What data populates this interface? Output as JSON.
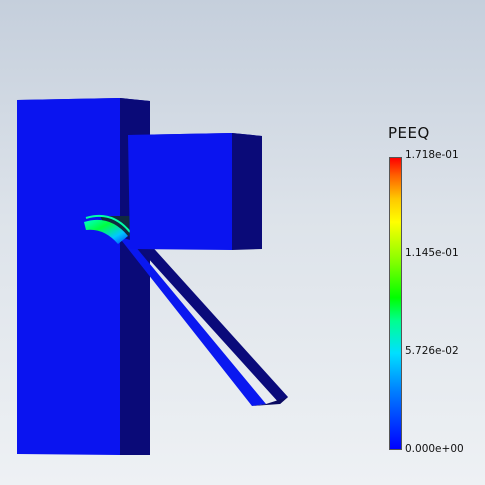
{
  "legend": {
    "title": "PEEQ",
    "ticks": [
      "1.718e-01",
      "1.145e-01",
      "5.726e-02",
      "0.000e+00"
    ],
    "range": [
      0.0,
      0.1718
    ],
    "colormap": [
      "#0000ff",
      "#00e0ff",
      "#00ff00",
      "#ffff00",
      "#ff0000"
    ]
  },
  "colors": {
    "model_front": "#0a14f0",
    "model_side": "#0a0a78",
    "background_top": "#c5cfdc",
    "background_bottom": "#eef1f4"
  }
}
